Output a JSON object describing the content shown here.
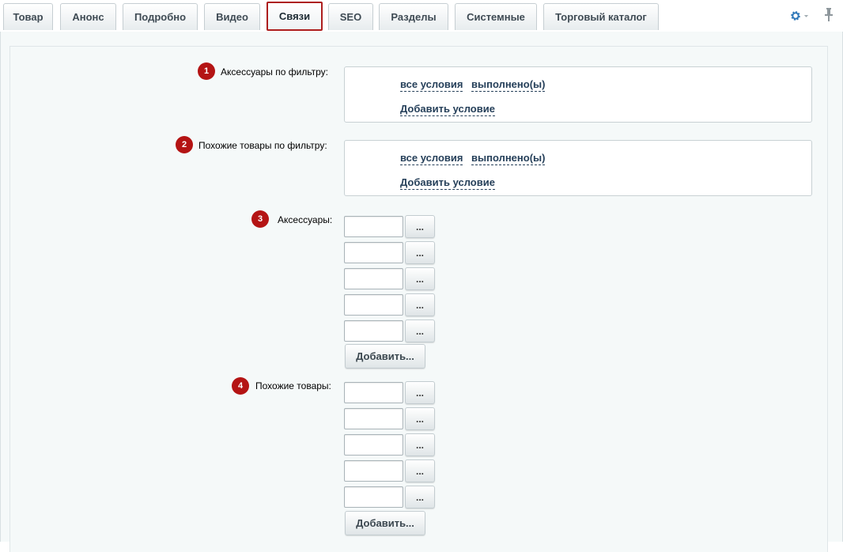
{
  "tabs": [
    {
      "label": "Товар"
    },
    {
      "label": "Анонс"
    },
    {
      "label": "Подробно"
    },
    {
      "label": "Видео"
    },
    {
      "label": "Связи"
    },
    {
      "label": "SEO"
    },
    {
      "label": "Разделы"
    },
    {
      "label": "Системные"
    },
    {
      "label": "Торговый каталог"
    }
  ],
  "active_tab": "Связи",
  "toolbar": {
    "settings_icon": "gear-icon",
    "pin_icon": "pin-icon"
  },
  "accent_color": "#b41414",
  "link_color": "#26405a",
  "sections": {
    "acc_filter": {
      "badge": "1",
      "label": "Аксессуары по фильтру:",
      "cond_all": "все условия",
      "cond_done": "выполнено(ы)",
      "add_condition": "Добавить условие"
    },
    "similar_filter": {
      "badge": "2",
      "label": "Похожие товары по фильтру:",
      "cond_all": "все условия",
      "cond_done": "выполнено(ы)",
      "add_condition": "Добавить условие"
    },
    "accessories": {
      "badge": "3",
      "label": "Аксессуары:",
      "inputs": [
        "",
        "",
        "",
        "",
        ""
      ],
      "browse_label": "...",
      "add_label": "Добавить..."
    },
    "similar": {
      "badge": "4",
      "label": "Похожие товары:",
      "inputs": [
        "",
        "",
        "",
        "",
        ""
      ],
      "browse_label": "...",
      "add_label": "Добавить..."
    }
  }
}
